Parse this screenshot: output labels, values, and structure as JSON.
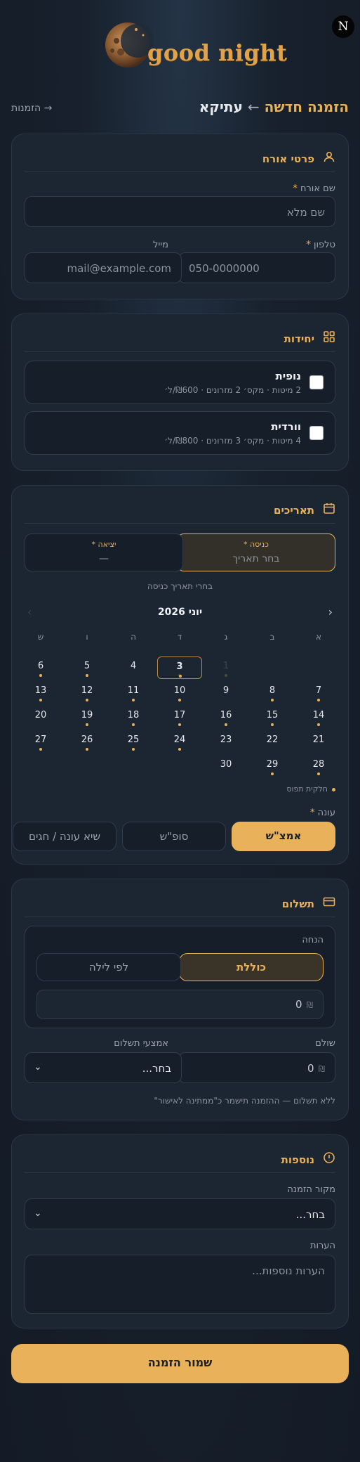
{
  "header": {
    "logo_text": "good night",
    "badge": "N",
    "breadcrumb_parent": "עתיקא",
    "breadcrumb_arrow": "←",
    "breadcrumb_current": "הזמנה חדשה",
    "back_link": "→ הזמנות"
  },
  "guest": {
    "title": "פרטי אורח",
    "name_label": "שם אורח",
    "name_placeholder": "שם מלא",
    "phone_label": "טלפון",
    "phone_placeholder": "050-0000000",
    "email_label": "מייל",
    "email_placeholder": "mail@example.com",
    "required_mark": "*"
  },
  "units": {
    "title": "יחידות",
    "items": [
      {
        "name": "נופית",
        "desc": "2 מיטות · מקס׳ 2 מזרונים · ₪600/ל׳",
        "checked": false
      },
      {
        "name": "וורדית",
        "desc": "4 מיטות · מקס׳ 3 מזרונים · ₪800/ל׳",
        "checked": false
      }
    ]
  },
  "dates": {
    "title": "תאריכים",
    "checkin_label": "כניסה *",
    "checkin_placeholder": "בחר תאריך",
    "checkout_label": "יציאה *",
    "checkout_value": "—",
    "hint": "בחרי תאריך כניסה",
    "calendar_title": "יוני 2026",
    "prev": "‹",
    "next": "›",
    "weekdays": [
      "א",
      "ב",
      "ג",
      "ד",
      "ה",
      "ו",
      "ש"
    ],
    "days": {
      "d1": "1",
      "d2": "2",
      "d3": "3",
      "d4": "4",
      "d5": "5",
      "d6": "6",
      "d7": "7",
      "d8": "8",
      "d9": "9",
      "d10": "10",
      "d11": "11",
      "d12": "12",
      "d13": "13",
      "d14": "14",
      "d15": "15",
      "d16": "16",
      "d17": "17",
      "d18": "18",
      "d19": "19",
      "d20": "20",
      "d21": "21",
      "d22": "22",
      "d23": "23",
      "d24": "24",
      "d25": "25",
      "d26": "26",
      "d27": "27",
      "d28": "28",
      "d29": "29",
      "d30": "30"
    },
    "legend": "חלקית תפוס",
    "season_label": "עונה",
    "seasons": [
      "אמצ\"ש",
      "סופ\"ש",
      "שיא עונה / חגים"
    ],
    "selected_season": "אמצ\"ש"
  },
  "payment": {
    "title": "תשלום",
    "discount_label": "הנחה",
    "discount_modes": [
      "כוללת",
      "לפי לילה"
    ],
    "selected_mode": "כוללת",
    "discount_value": "0",
    "currency": "₪",
    "paid_label": "שולם",
    "paid_value": "0",
    "method_label": "אמצעי תשלום",
    "method_value": "בחר...",
    "note": "ללא תשלום — ההזמנה תישמר כ\"ממתינה לאישור\""
  },
  "extras": {
    "title": "נוספות",
    "source_label": "מקור הזמנה",
    "source_value": "בחר...",
    "notes_label": "הערות",
    "notes_placeholder": "הערות נוספות..."
  },
  "save_button": "שמור הזמנה",
  "colors": {
    "accent": "#e8b15a",
    "bg": "#17202c",
    "card": "#1c2532"
  }
}
